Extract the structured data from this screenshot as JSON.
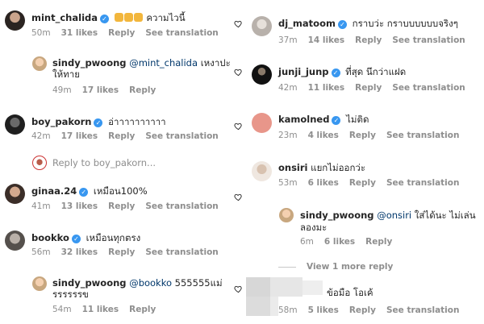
{
  "comments": {
    "mint": {
      "user": "mint_chalida",
      "text": "ความไวนี้",
      "time": "50m",
      "likes": "31 likes",
      "reply": "Reply",
      "translate": "See translation"
    },
    "sindy1": {
      "user": "sindy_pwoong",
      "mention": "@mint_chalida",
      "text": "เหงาปะ",
      "text2": "ให้ทาย",
      "time": "49m",
      "likes": "17 likes",
      "reply": "Reply"
    },
    "boy": {
      "user": "boy_pakorn",
      "text": "อ่าาาาาาาาาา",
      "time": "42m",
      "likes": "17 likes",
      "reply": "Reply",
      "translate": "See translation"
    },
    "boy_reply": {
      "text": "Reply to boy_pakorn..."
    },
    "ginaa": {
      "user": "ginaa.24",
      "text": "เหมือน100%",
      "time": "41m",
      "likes": "13 likes",
      "reply": "Reply",
      "translate": "See translation"
    },
    "bookko": {
      "user": "bookko",
      "text": "เหมือนทุกตรง",
      "time": "56m",
      "likes": "32 likes",
      "reply": "Reply",
      "translate": "See translation"
    },
    "sindy2": {
      "user": "sindy_pwoong",
      "mention": "@bookko",
      "text": "555555แม่",
      "text2": "รรรรรรข",
      "time": "54m",
      "likes": "11 likes",
      "reply": "Reply"
    },
    "djmatoom": {
      "user": "dj_matoom",
      "text": "กราบว่ะ กราบบบบบบจริงๆ",
      "time": "37m",
      "likes": "14 likes",
      "reply": "Reply",
      "translate": "See translation"
    },
    "junji": {
      "user": "junji_junp",
      "text": "ที่สุด นึกว่าแฝด",
      "time": "42m",
      "likes": "11 likes",
      "reply": "Reply",
      "translate": "See translation"
    },
    "kamolned": {
      "user": "kamolned",
      "text": "ไม่ติด",
      "time": "23m",
      "likes": "4 likes",
      "reply": "Reply",
      "translate": "See translation"
    },
    "onsiri": {
      "user": "onsiri",
      "text": "แยกไม่ออกว่ะ",
      "time": "53m",
      "likes": "6 likes",
      "reply": "Reply",
      "translate": "See translation"
    },
    "sindy3": {
      "user": "sindy_pwoong",
      "mention": "@onsiri",
      "text": "ใส่ได้นะ ไม่เล่น",
      "text2": "ลองมะ",
      "time": "6m",
      "likes": "6 likes",
      "reply": "Reply"
    },
    "viewmore": {
      "text": "View 1 more reply"
    },
    "blurred": {
      "text": "ข้อมือ โอเค้",
      "time": "58m",
      "likes": "5 likes",
      "reply": "Reply",
      "translate": "See translation"
    }
  },
  "colors": {
    "verified": "#3897f0",
    "mention": "#00376b",
    "meta": "#8e8e8e",
    "kamolned_avatar": "#e8968a"
  },
  "icons": {
    "heart": "heart-outline-icon",
    "verified": "verified-badge-icon"
  }
}
